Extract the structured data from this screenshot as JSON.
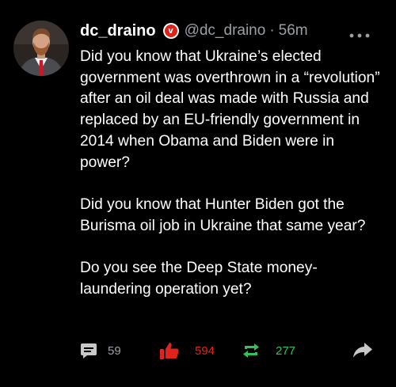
{
  "post": {
    "display_name": "dc_draino",
    "verified_badge": "v",
    "handle": "@dc_draino",
    "separator": "·",
    "time": "56m",
    "more_icon": "more-horizontal-icon",
    "paragraphs": [
      "Did you know that Ukraine’s elected government was overthrown in a “revolution” after an oil deal was made with Russia and replaced by an EU-friendly government in 2014 when Obama and Biden were in power?",
      "Did you know that Hunter Biden got the Burisma oil job in Ukraine that same year?",
      "Do you see the Deep State money-laundering operation yet?"
    ]
  },
  "actions": {
    "comments": {
      "icon": "comment-icon",
      "count": "59"
    },
    "likes": {
      "icon": "thumbs-up-icon",
      "count": "594"
    },
    "reposts": {
      "icon": "repost-icon",
      "count": "277"
    },
    "share": {
      "icon": "share-icon"
    }
  },
  "colors": {
    "background": "#000000",
    "text": "#ffffff",
    "muted": "#9aa0a6",
    "badge_red": "#d9231d",
    "like_red": "#e0241b",
    "repost_green": "#2ec45a",
    "icon_gray": "#c8c8c8"
  }
}
